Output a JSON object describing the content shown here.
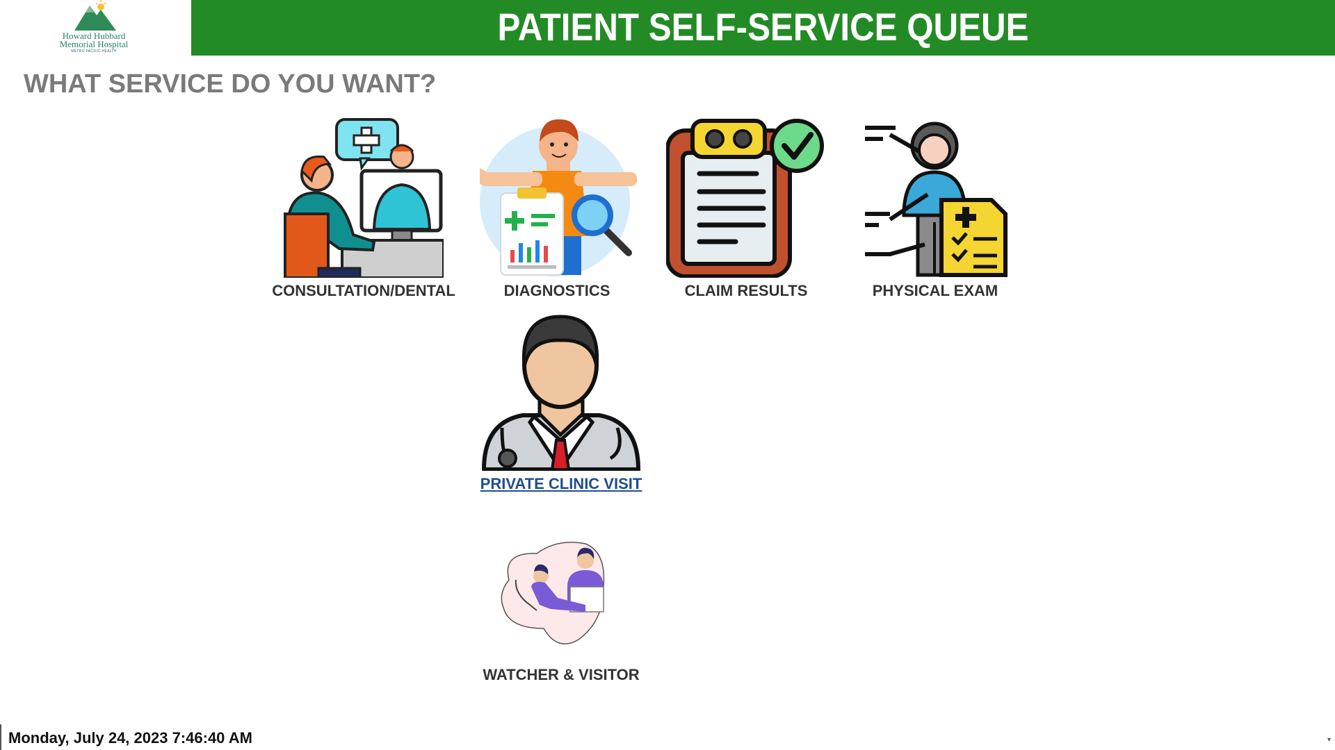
{
  "logo": {
    "line1": "Howard Hubbard",
    "line2": "Memorial Hospital",
    "sub": "METRO PACIFIC HEALTH"
  },
  "header": {
    "title": "PATIENT SELF-SERVICE QUEUE"
  },
  "prompt": {
    "question": "WHAT SERVICE DO YOU WANT?"
  },
  "services": [
    {
      "label": "CONSULTATION/DENTAL",
      "icon": "doctor-telemedicine-icon"
    },
    {
      "label": "DIAGNOSTICS",
      "icon": "diagnostics-icon"
    },
    {
      "label": "CLAIM RESULTS",
      "icon": "clipboard-check-icon"
    },
    {
      "label": "PHYSICAL EXAM",
      "icon": "physical-exam-icon"
    },
    {
      "label": "PRIVATE CLINIC VISIT",
      "icon": "doctor-avatar-icon"
    },
    {
      "label": "WATCHER & VISITOR",
      "icon": "watcher-visitor-icon"
    }
  ],
  "footer": {
    "datetime": "Monday, July 24, 2023  7:46:40 AM"
  },
  "colors": {
    "header_green": "#238b26",
    "question_gray": "#7a7a7a",
    "link_blue": "#1f4e8c"
  }
}
